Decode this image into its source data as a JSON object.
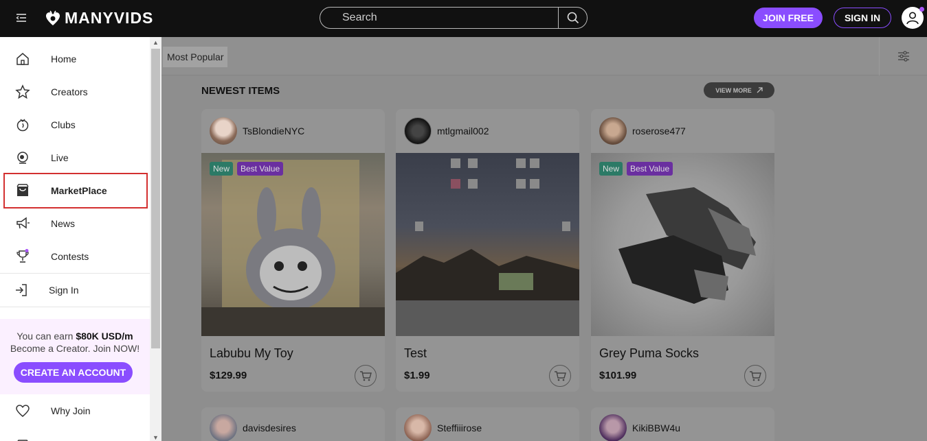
{
  "header": {
    "logo_text": "MANYVIDS",
    "search_placeholder": "Search",
    "join_label": "JOIN FREE",
    "signin_label": "SIGN IN"
  },
  "sidebar": {
    "items": [
      {
        "label": "Home",
        "icon": "home-icon"
      },
      {
        "label": "Creators",
        "icon": "star-icon"
      },
      {
        "label": "Clubs",
        "icon": "club-icon"
      },
      {
        "label": "Live",
        "icon": "live-icon"
      },
      {
        "label": "MarketPlace",
        "icon": "shop-icon"
      },
      {
        "label": "News",
        "icon": "megaphone-icon"
      },
      {
        "label": "Contests",
        "icon": "trophy-icon"
      }
    ],
    "signin_label": "Sign In",
    "promo": {
      "line1_prefix": "You can earn ",
      "line1_amount": "$80K USD/m",
      "line2": "Become a Creator. Join NOW!",
      "cta": "CREATE AN ACCOUNT"
    },
    "why_join": "Why Join"
  },
  "main": {
    "filter_pill": "Most Popular",
    "section_title": "NEWEST ITEMS",
    "view_more": "VIEW MORE",
    "badges": {
      "new": "New",
      "best_value": "Best Value"
    },
    "cards": [
      {
        "creator": "TsBlondieNYC",
        "title": "Labubu My Toy",
        "price": "$129.99"
      },
      {
        "creator": "mtlgmail002",
        "title": "Test",
        "price": "$1.99"
      },
      {
        "creator": "roserose477",
        "title": "Grey Puma Socks",
        "price": "$101.99"
      }
    ],
    "row2": [
      {
        "creator": "davisdesires"
      },
      {
        "creator": "Steffiiirose"
      },
      {
        "creator": "KikiBBW4u"
      }
    ]
  },
  "colors": {
    "accent": "#8a4dff",
    "topbar": "#111111",
    "highlight_border": "#d32f2f"
  }
}
